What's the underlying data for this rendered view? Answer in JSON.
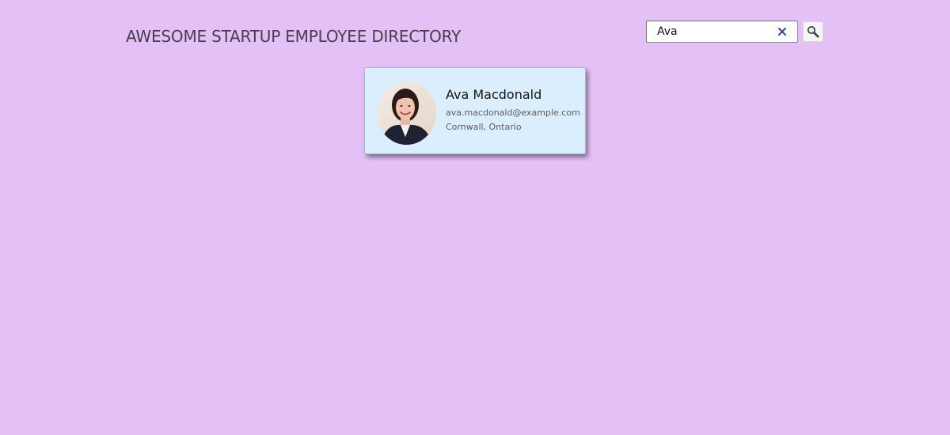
{
  "header": {
    "title": "AWESOME STARTUP EMPLOYEE DIRECTORY"
  },
  "search": {
    "value": "Ava",
    "clear_icon": "close-icon",
    "button_icon": "search-icon"
  },
  "results": [
    {
      "name": "Ava Macdonald",
      "email": "ava.macdonald@example.com",
      "location": "Cornwall, Ontario",
      "avatar_icon": "avatar"
    }
  ],
  "colors": {
    "background": "#e3c1f6",
    "card_background": "#dbeefd",
    "title_text": "#4a3b4e",
    "clear_icon": "#2b4a8c"
  }
}
